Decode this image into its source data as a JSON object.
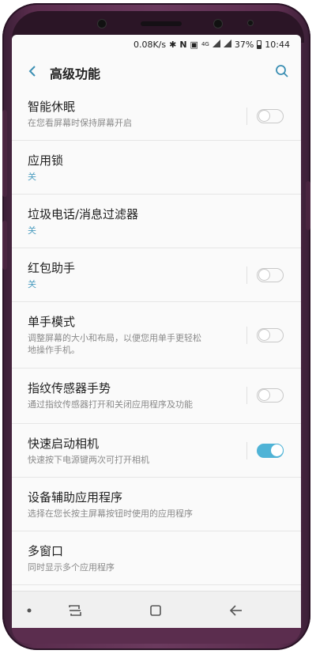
{
  "status_bar": {
    "speed": "0.08K/s",
    "network": "4G",
    "battery": "37%",
    "time": "10:44"
  },
  "app_bar": {
    "title": "高级功能"
  },
  "settings": [
    {
      "title": "智能休眠",
      "subtitle": "在您看屏幕时保持屏幕开启",
      "subtitle_style": "gray",
      "toggle": "off"
    },
    {
      "title": "应用锁",
      "subtitle": "关",
      "subtitle_style": "accent",
      "toggle": null
    },
    {
      "title": "垃圾电话/消息过滤器",
      "subtitle": "关",
      "subtitle_style": "accent",
      "toggle": null
    },
    {
      "title": "红包助手",
      "subtitle": "关",
      "subtitle_style": "accent",
      "toggle": "off"
    },
    {
      "title": "单手模式",
      "subtitle": "调整屏幕的大小和布局，以便您用单手更轻松地操作手机。",
      "subtitle_style": "gray",
      "toggle": "off"
    },
    {
      "title": "指纹传感器手势",
      "subtitle": "通过指纹传感器打开和关闭应用程序及功能",
      "subtitle_style": "gray",
      "toggle": "off"
    },
    {
      "title": "快速启动相机",
      "subtitle": "快速按下电源键两次可打开相机",
      "subtitle_style": "gray",
      "toggle": "on"
    },
    {
      "title": "设备辅助应用程序",
      "subtitle": "选择在您长按主屏幕按钮时使用的应用程序",
      "subtitle_style": "gray",
      "toggle": null
    },
    {
      "title": "多窗口",
      "subtitle": "同时显示多个应用程序",
      "subtitle_style": "gray",
      "toggle": null
    }
  ],
  "colors": {
    "accent": "#4fb3d6",
    "accent_text": "#4e9ec0",
    "frame": "#5b2d4e"
  },
  "icons": {
    "back": "chevron-left-icon",
    "search": "search-icon",
    "recents": "recents-icon",
    "home": "home-icon",
    "nav_back": "back-arrow-icon"
  }
}
